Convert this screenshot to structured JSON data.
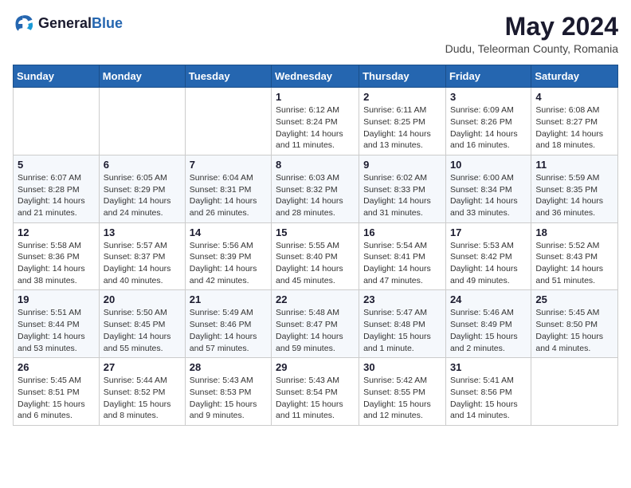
{
  "header": {
    "logo_general": "General",
    "logo_blue": "Blue",
    "month_title": "May 2024",
    "location": "Dudu, Teleorman County, Romania"
  },
  "weekdays": [
    "Sunday",
    "Monday",
    "Tuesday",
    "Wednesday",
    "Thursday",
    "Friday",
    "Saturday"
  ],
  "weeks": [
    [
      {
        "day": "",
        "info": ""
      },
      {
        "day": "",
        "info": ""
      },
      {
        "day": "",
        "info": ""
      },
      {
        "day": "1",
        "info": "Sunrise: 6:12 AM\nSunset: 8:24 PM\nDaylight: 14 hours\nand 11 minutes."
      },
      {
        "day": "2",
        "info": "Sunrise: 6:11 AM\nSunset: 8:25 PM\nDaylight: 14 hours\nand 13 minutes."
      },
      {
        "day": "3",
        "info": "Sunrise: 6:09 AM\nSunset: 8:26 PM\nDaylight: 14 hours\nand 16 minutes."
      },
      {
        "day": "4",
        "info": "Sunrise: 6:08 AM\nSunset: 8:27 PM\nDaylight: 14 hours\nand 18 minutes."
      }
    ],
    [
      {
        "day": "5",
        "info": "Sunrise: 6:07 AM\nSunset: 8:28 PM\nDaylight: 14 hours\nand 21 minutes."
      },
      {
        "day": "6",
        "info": "Sunrise: 6:05 AM\nSunset: 8:29 PM\nDaylight: 14 hours\nand 24 minutes."
      },
      {
        "day": "7",
        "info": "Sunrise: 6:04 AM\nSunset: 8:31 PM\nDaylight: 14 hours\nand 26 minutes."
      },
      {
        "day": "8",
        "info": "Sunrise: 6:03 AM\nSunset: 8:32 PM\nDaylight: 14 hours\nand 28 minutes."
      },
      {
        "day": "9",
        "info": "Sunrise: 6:02 AM\nSunset: 8:33 PM\nDaylight: 14 hours\nand 31 minutes."
      },
      {
        "day": "10",
        "info": "Sunrise: 6:00 AM\nSunset: 8:34 PM\nDaylight: 14 hours\nand 33 minutes."
      },
      {
        "day": "11",
        "info": "Sunrise: 5:59 AM\nSunset: 8:35 PM\nDaylight: 14 hours\nand 36 minutes."
      }
    ],
    [
      {
        "day": "12",
        "info": "Sunrise: 5:58 AM\nSunset: 8:36 PM\nDaylight: 14 hours\nand 38 minutes."
      },
      {
        "day": "13",
        "info": "Sunrise: 5:57 AM\nSunset: 8:37 PM\nDaylight: 14 hours\nand 40 minutes."
      },
      {
        "day": "14",
        "info": "Sunrise: 5:56 AM\nSunset: 8:39 PM\nDaylight: 14 hours\nand 42 minutes."
      },
      {
        "day": "15",
        "info": "Sunrise: 5:55 AM\nSunset: 8:40 PM\nDaylight: 14 hours\nand 45 minutes."
      },
      {
        "day": "16",
        "info": "Sunrise: 5:54 AM\nSunset: 8:41 PM\nDaylight: 14 hours\nand 47 minutes."
      },
      {
        "day": "17",
        "info": "Sunrise: 5:53 AM\nSunset: 8:42 PM\nDaylight: 14 hours\nand 49 minutes."
      },
      {
        "day": "18",
        "info": "Sunrise: 5:52 AM\nSunset: 8:43 PM\nDaylight: 14 hours\nand 51 minutes."
      }
    ],
    [
      {
        "day": "19",
        "info": "Sunrise: 5:51 AM\nSunset: 8:44 PM\nDaylight: 14 hours\nand 53 minutes."
      },
      {
        "day": "20",
        "info": "Sunrise: 5:50 AM\nSunset: 8:45 PM\nDaylight: 14 hours\nand 55 minutes."
      },
      {
        "day": "21",
        "info": "Sunrise: 5:49 AM\nSunset: 8:46 PM\nDaylight: 14 hours\nand 57 minutes."
      },
      {
        "day": "22",
        "info": "Sunrise: 5:48 AM\nSunset: 8:47 PM\nDaylight: 14 hours\nand 59 minutes."
      },
      {
        "day": "23",
        "info": "Sunrise: 5:47 AM\nSunset: 8:48 PM\nDaylight: 15 hours\nand 1 minute."
      },
      {
        "day": "24",
        "info": "Sunrise: 5:46 AM\nSunset: 8:49 PM\nDaylight: 15 hours\nand 2 minutes."
      },
      {
        "day": "25",
        "info": "Sunrise: 5:45 AM\nSunset: 8:50 PM\nDaylight: 15 hours\nand 4 minutes."
      }
    ],
    [
      {
        "day": "26",
        "info": "Sunrise: 5:45 AM\nSunset: 8:51 PM\nDaylight: 15 hours\nand 6 minutes."
      },
      {
        "day": "27",
        "info": "Sunrise: 5:44 AM\nSunset: 8:52 PM\nDaylight: 15 hours\nand 8 minutes."
      },
      {
        "day": "28",
        "info": "Sunrise: 5:43 AM\nSunset: 8:53 PM\nDaylight: 15 hours\nand 9 minutes."
      },
      {
        "day": "29",
        "info": "Sunrise: 5:43 AM\nSunset: 8:54 PM\nDaylight: 15 hours\nand 11 minutes."
      },
      {
        "day": "30",
        "info": "Sunrise: 5:42 AM\nSunset: 8:55 PM\nDaylight: 15 hours\nand 12 minutes."
      },
      {
        "day": "31",
        "info": "Sunrise: 5:41 AM\nSunset: 8:56 PM\nDaylight: 15 hours\nand 14 minutes."
      },
      {
        "day": "",
        "info": ""
      }
    ]
  ]
}
